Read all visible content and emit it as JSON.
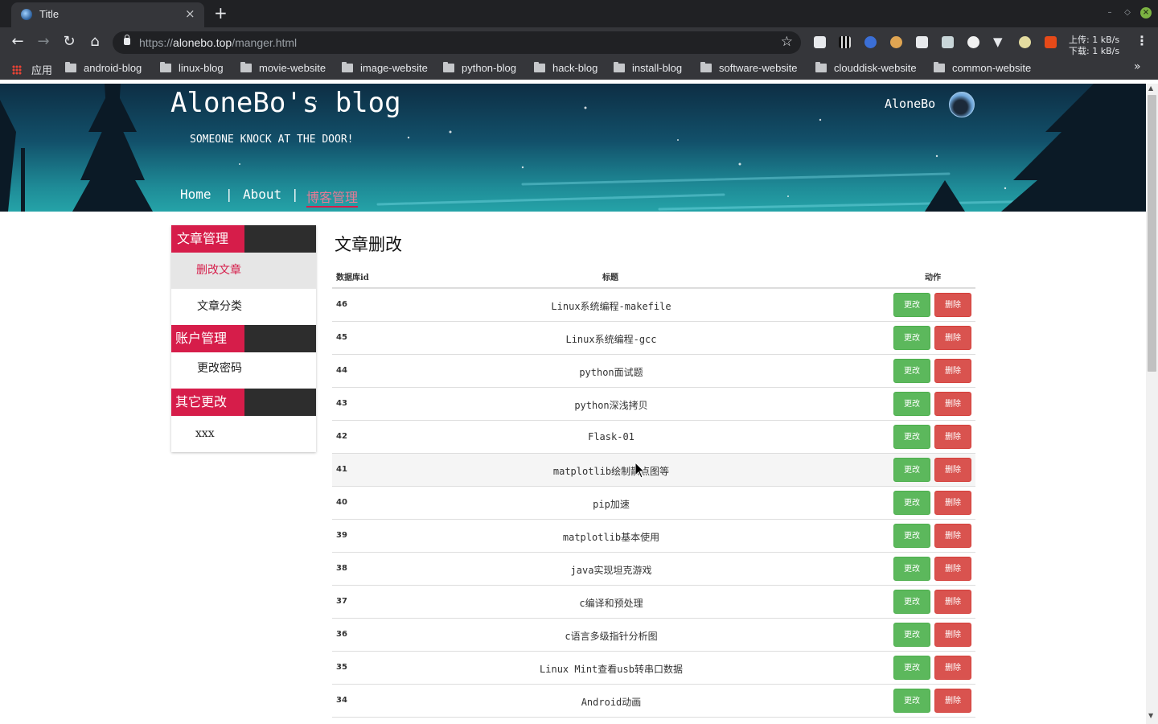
{
  "browser": {
    "tab_title": "Title",
    "tab_close": "×",
    "new_tab": "+",
    "url_prefix": "https://",
    "url_host": "alonebo.top",
    "url_path": "/manger.html",
    "net_upload": "上传: 1 kB/s",
    "net_download": "下载: 1 kB/s",
    "bookmarks": [
      "应用",
      "android-blog",
      "linux-blog",
      "movie-website",
      "image-website",
      "python-blog",
      "hack-blog",
      "install-blog",
      "software-website",
      "clouddisk-website",
      "common-website"
    ]
  },
  "site": {
    "title": "AloneBo's blog",
    "subtitle": "SOMEONE KNOCK AT THE DOOR!",
    "user": "AloneBo",
    "nav": [
      "Home",
      "|",
      "About",
      "|",
      "博客管理"
    ]
  },
  "sidebar": {
    "groups": [
      {
        "label": "文章管理",
        "items": [
          "删改文章",
          "文章分类"
        ]
      },
      {
        "label": "账户管理",
        "items": [
          "更改密码"
        ]
      },
      {
        "label": "其它更改",
        "items": [
          "xxx"
        ]
      }
    ]
  },
  "content": {
    "heading": "文章删改",
    "columns": [
      "数据库id",
      "标题",
      "动作"
    ],
    "edit_label": "更改",
    "delete_label": "删除",
    "rows": [
      {
        "id": "46",
        "title": "Linux系统编程-makefile"
      },
      {
        "id": "45",
        "title": "Linux系统编程-gcc"
      },
      {
        "id": "44",
        "title": "python面试题"
      },
      {
        "id": "43",
        "title": "python深浅拷贝"
      },
      {
        "id": "42",
        "title": "Flask-01"
      },
      {
        "id": "41",
        "title": "matplotlib绘制散点图等"
      },
      {
        "id": "40",
        "title": "pip加速"
      },
      {
        "id": "39",
        "title": "matplotlib基本使用"
      },
      {
        "id": "38",
        "title": "java实现坦克游戏"
      },
      {
        "id": "37",
        "title": "c编译和预处理"
      },
      {
        "id": "36",
        "title": "c语言多级指针分析图"
      },
      {
        "id": "35",
        "title": "Linux Mint查看usb转串口数据"
      },
      {
        "id": "34",
        "title": "Android动画"
      }
    ]
  }
}
